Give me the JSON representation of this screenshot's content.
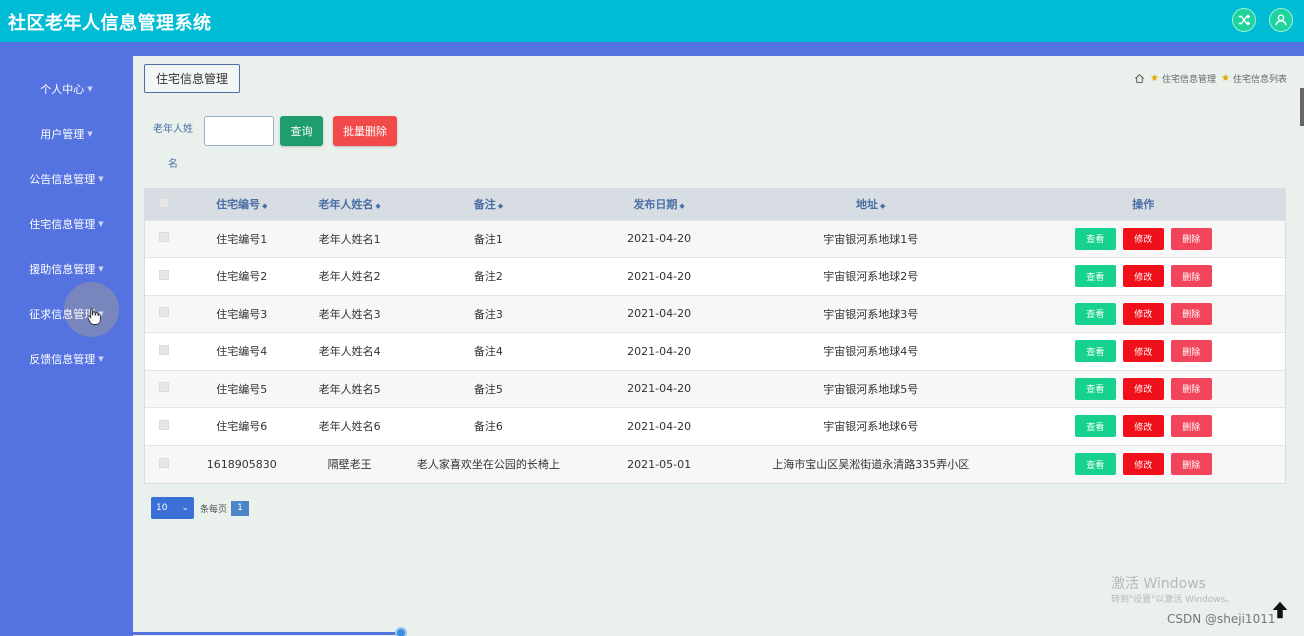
{
  "app": {
    "title": "社区老年人信息管理系统"
  },
  "header": {
    "icons": [
      "shuffle-icon",
      "user-icon"
    ]
  },
  "sidebar": {
    "items": [
      {
        "label": "个人中心"
      },
      {
        "label": "用户管理"
      },
      {
        "label": "公告信息管理"
      },
      {
        "label": "住宅信息管理"
      },
      {
        "label": "援助信息管理"
      },
      {
        "label": "征求信息管理"
      },
      {
        "label": "反馈信息管理"
      }
    ]
  },
  "page": {
    "tag": "住宅信息管理",
    "breadcrumb": [
      "住宅信息管理",
      "住宅信息列表"
    ]
  },
  "search": {
    "label": "老年人姓名",
    "value": "",
    "query_button": "查询",
    "batch_delete_button": "批量删除"
  },
  "table": {
    "columns": [
      "住宅编号",
      "老年人姓名",
      "备注",
      "发布日期",
      "地址",
      "操作"
    ],
    "rows": [
      {
        "id": "住宅编号1",
        "name": "老年人姓名1",
        "note": "备注1",
        "date": "2021-04-20",
        "address": "宇宙银河系地球1号"
      },
      {
        "id": "住宅编号2",
        "name": "老年人姓名2",
        "note": "备注2",
        "date": "2021-04-20",
        "address": "宇宙银河系地球2号"
      },
      {
        "id": "住宅编号3",
        "name": "老年人姓名3",
        "note": "备注3",
        "date": "2021-04-20",
        "address": "宇宙银河系地球3号"
      },
      {
        "id": "住宅编号4",
        "name": "老年人姓名4",
        "note": "备注4",
        "date": "2021-04-20",
        "address": "宇宙银河系地球4号"
      },
      {
        "id": "住宅编号5",
        "name": "老年人姓名5",
        "note": "备注5",
        "date": "2021-04-20",
        "address": "宇宙银河系地球5号"
      },
      {
        "id": "住宅编号6",
        "name": "老年人姓名6",
        "note": "备注6",
        "date": "2021-04-20",
        "address": "宇宙银河系地球6号"
      },
      {
        "id": "1618905830",
        "name": "隔壁老王",
        "note": "老人家喜欢坐在公园的长椅上",
        "date": "2021-05-01",
        "address": "上海市宝山区吴淞街道永清路335弄小区"
      }
    ],
    "actions": {
      "view": "查看",
      "edit": "修改",
      "delete": "删除"
    }
  },
  "pager": {
    "page_size": "10",
    "page_size_label": "条每页",
    "current_page": "1"
  },
  "overlay": {
    "windows_watermark_title": "激活 Windows",
    "windows_watermark_sub": "转到\"设置\"以激活 Windows。",
    "csdn_watermark": "CSDN @sheji1011"
  },
  "colors": {
    "topbar": "#00bcd4",
    "sidebar": "#5473e0",
    "view_button": "#17d28f",
    "edit_button": "#f0101a",
    "delete_button": "#f2445a",
    "query_button": "#1e9e6e"
  }
}
